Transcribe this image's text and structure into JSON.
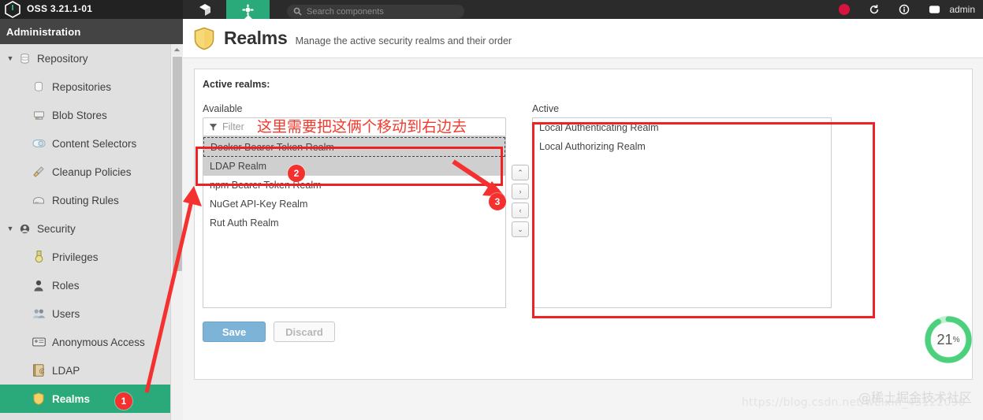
{
  "topbar": {
    "product_name": "OSS 3.21.1-01",
    "logo_icon": "nexus-hex-logo-icon",
    "icons": [
      {
        "name": "cube-icon",
        "active": false
      },
      {
        "name": "gear-icon",
        "active": true
      }
    ],
    "search": {
      "icon": "search-icon",
      "placeholder": "Search components",
      "value": ""
    },
    "right_icons": [
      {
        "name": "alert-badge-icon"
      },
      {
        "name": "refresh-icon"
      },
      {
        "name": "help-info-icon"
      },
      {
        "name": "user-avatar-icon"
      }
    ],
    "user_label": "admin"
  },
  "sidebar": {
    "header": "Administration",
    "groups": [
      {
        "label": "Repository",
        "icon": "database-icon",
        "expanded": true,
        "items": [
          {
            "label": "Repositories",
            "icon": "database-icon",
            "selected": false
          },
          {
            "label": "Blob Stores",
            "icon": "blob-store-icon",
            "selected": false
          },
          {
            "label": "Content Selectors",
            "icon": "content-selector-icon",
            "selected": false
          },
          {
            "label": "Cleanup Policies",
            "icon": "broom-icon",
            "selected": false
          },
          {
            "label": "Routing Rules",
            "icon": "routing-rule-icon",
            "selected": false
          }
        ]
      },
      {
        "label": "Security",
        "icon": "security-shield-icon",
        "expanded": true,
        "items": [
          {
            "label": "Privileges",
            "icon": "medal-icon",
            "selected": false
          },
          {
            "label": "Roles",
            "icon": "roles-person-icon",
            "selected": false
          },
          {
            "label": "Users",
            "icon": "users-icon",
            "selected": false
          },
          {
            "label": "Anonymous Access",
            "icon": "id-card-icon",
            "selected": false
          },
          {
            "label": "LDAP",
            "icon": "address-book-icon",
            "selected": false
          },
          {
            "label": "Realms",
            "icon": "shield-icon",
            "selected": true
          }
        ]
      }
    ],
    "scrollbar": {
      "up_arrow_icon": "scroll-up-arrow-icon"
    }
  },
  "page": {
    "icon": "shield-icon",
    "title": "Realms",
    "subtitle": "Manage the active security realms and their order"
  },
  "panel": {
    "section_label": "Active realms:",
    "available": {
      "label": "Available",
      "filter": {
        "icon": "filter-icon",
        "placeholder": "Filter",
        "value": ""
      },
      "items": [
        {
          "label": "Docker Bearer Token Realm",
          "selected": true,
          "focused": true
        },
        {
          "label": "LDAP Realm",
          "selected": true,
          "focused": false
        },
        {
          "label": "npm Bearer Token Realm",
          "selected": false,
          "focused": false
        },
        {
          "label": "NuGet API-Key Realm",
          "selected": false,
          "focused": false
        },
        {
          "label": "Rut Auth Realm",
          "selected": false,
          "focused": false
        }
      ]
    },
    "active": {
      "label": "Active",
      "items": [
        {
          "label": "Local Authenticating Realm"
        },
        {
          "label": "Local Authorizing Realm"
        }
      ]
    },
    "transfer_buttons": [
      {
        "name": "move-up-button",
        "glyph": "⌃"
      },
      {
        "name": "move-right-button",
        "glyph": "›"
      },
      {
        "name": "move-left-button",
        "glyph": "‹"
      },
      {
        "name": "move-down-button",
        "glyph": "⌄"
      }
    ],
    "save_label": "Save",
    "discard_label": "Discard"
  },
  "annotations": {
    "note_text": "这里需要把这俩个移动到右边去",
    "badges": [
      {
        "id": "1",
        "number": "1"
      },
      {
        "id": "2",
        "number": "2"
      },
      {
        "id": "3",
        "number": "3"
      }
    ],
    "highlight_color": "#ee2222",
    "badge_color": "#f4312f"
  },
  "overlay": {
    "progress_percent": "21",
    "progress_unit": "%",
    "progress_color": "#4cd07d",
    "watermark_url": "https://blog.csdn.net/weixin_43122090",
    "watermark_brand": "@稀土掘金技术社区"
  }
}
